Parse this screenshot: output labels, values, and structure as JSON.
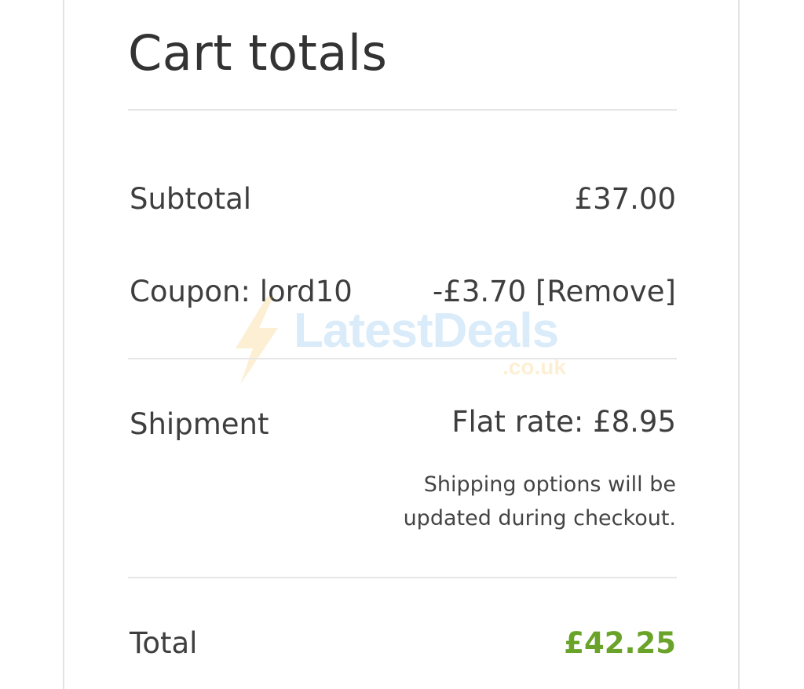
{
  "cart_totals": {
    "title": "Cart totals",
    "subtotal": {
      "label": "Subtotal",
      "value": "£37.00"
    },
    "coupon": {
      "label": "Coupon: lord10",
      "amount": "-£3.70",
      "remove_label": "[Remove]"
    },
    "shipment": {
      "label": "Shipment",
      "value": "Flat rate: £8.95",
      "note_line1": "Shipping options will be",
      "note_line2": "updated during checkout."
    },
    "total": {
      "label": "Total",
      "value": "£42.25",
      "color": "#6aa329"
    }
  },
  "watermark": {
    "name": "LatestDeals",
    "domain": ".co.uk",
    "icon": "lightning-bolt-icon"
  }
}
